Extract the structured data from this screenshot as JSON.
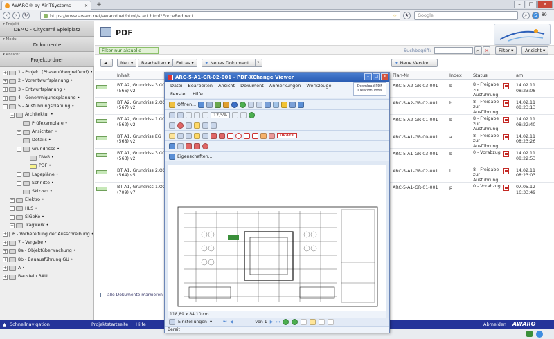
{
  "browser": {
    "tab_title": "AWARO® by AirITSystems",
    "url": "https://www.awaro.net/awaro/net/html/start.html?ForceRedirect",
    "search_engine": "Google"
  },
  "sidebar": {
    "sections": [
      {
        "label": "Projekt",
        "value": "DEMO - Citycarré Spielplatz"
      },
      {
        "label": "Modul",
        "value": "Dokumente"
      },
      {
        "label": "Ansicht",
        "value": "Projektordner"
      }
    ],
    "tree": [
      {
        "level": 0,
        "pm": "+",
        "label": "1 - Projekt (Phasenübergreifend) •"
      },
      {
        "level": 0,
        "pm": "+",
        "label": "2 - Vorentwurfsplanung •"
      },
      {
        "level": 0,
        "pm": "+",
        "label": "3 - Entwurfsplanung •"
      },
      {
        "level": 0,
        "pm": "+",
        "label": "4 - Genehmigungsplanung •"
      },
      {
        "level": 0,
        "pm": "−",
        "label": "5 - Ausführungsplanung •"
      },
      {
        "level": 1,
        "pm": "−",
        "label": "Architektur •"
      },
      {
        "level": 2,
        "pm": "",
        "label": "Prüfexemplare •"
      },
      {
        "level": 2,
        "pm": "+",
        "label": "Ansichten •"
      },
      {
        "level": 2,
        "pm": "",
        "label": "Details •"
      },
      {
        "level": 2,
        "pm": "−",
        "label": "Grundrisse •"
      },
      {
        "level": 3,
        "pm": "",
        "label": "DWG •"
      },
      {
        "level": 3,
        "pm": "",
        "label": "PDF •",
        "selected": true
      },
      {
        "level": 2,
        "pm": "+",
        "label": "Lagepläne •"
      },
      {
        "level": 2,
        "pm": "+",
        "label": "Schnitte •"
      },
      {
        "level": 2,
        "pm": "",
        "label": "Skizzen •"
      },
      {
        "level": 1,
        "pm": "+",
        "label": "Elektro •"
      },
      {
        "level": 1,
        "pm": "+",
        "label": "HLS •"
      },
      {
        "level": 1,
        "pm": "+",
        "label": "SiGeKo •"
      },
      {
        "level": 1,
        "pm": "+",
        "label": "Tragwerk •"
      },
      {
        "level": 0,
        "pm": "+",
        "label": "6 - Vorbereitung der Ausschreibung •"
      },
      {
        "level": 0,
        "pm": "+",
        "label": "7 - Vergabe •"
      },
      {
        "level": 0,
        "pm": "+",
        "label": "8a - Objektüberwachung •"
      },
      {
        "level": 0,
        "pm": "+",
        "label": "8b - Bauausführung GU •"
      },
      {
        "level": 0,
        "pm": "+",
        "label": "A •"
      },
      {
        "level": 0,
        "pm": "+",
        "label": "Baustein BAU"
      }
    ]
  },
  "main": {
    "title": "PDF",
    "filter_active": "Filter nur aktuelle",
    "search_label": "Suchbegriff:",
    "filter_btn": "Filter",
    "view_btn": "Ansicht",
    "toolbar": {
      "back": "",
      "new": "Neu",
      "edit": "Bearbeiten",
      "extras": "Extras",
      "new_doc": "Neues Dokument...",
      "help": "?",
      "new_version": "Neue Version..."
    },
    "columns": {
      "content": "Inhalt",
      "plan_no": "Plan-Nr",
      "index": "Index",
      "status": "Status",
      "date": "am"
    },
    "rows": [
      {
        "content1": "BT A2, Grundriss 3.OG",
        "content2": "(566) v2",
        "plan": "ARC-5-A2-GR-03-001",
        "index": "b",
        "status": "8 - Freigabe zur Ausführung",
        "date": "14.02.11",
        "time": "08:23:08"
      },
      {
        "content1": "BT A2, Grundriss 2.OG",
        "content2": "(567) v2",
        "plan": "ARC-5-A2-GR-02-001",
        "index": "b",
        "status": "8 - Freigabe zur Ausführung",
        "date": "14.02.11",
        "time": "08:23:13"
      },
      {
        "content1": "BT A2, Grundriss 1.OG",
        "content2": "(562) v2",
        "plan": "ARC-5-A2-GR-01-001",
        "index": "b",
        "status": "8 - Freigabe zur Ausführung",
        "date": "14.02.11",
        "time": "08:22:40"
      },
      {
        "content1": "BT A1, Grundriss EG",
        "content2": "(568) v2",
        "plan": "ARC-5-A1-GR-00-001",
        "index": "a",
        "status": "8 - Freigabe zur Ausführung",
        "date": "14.02.11",
        "time": "08:23:26"
      },
      {
        "content1": "BT A1, Grundriss 3.OG",
        "content2": "(563) v2",
        "plan": "ARC-5-A1-GR-03-001",
        "index": "b",
        "status": "0 - Vorabzug",
        "date": "14.02.11",
        "time": "08:22:53"
      },
      {
        "content1": "BT A1, Grundriss 2.OG",
        "content2": "(564) v5",
        "plan": "ARC-5-A1-GR-02-001",
        "index": "l",
        "status": "8 - Freigabe zur Ausführung",
        "date": "14.02.11",
        "time": "08:23:03"
      },
      {
        "content1": "BT A1, Grundriss 1.OG",
        "content2": "(709) v7",
        "plan": "ARC-5-A1-GR-01-001",
        "index": "p",
        "status": "0 - Vorabzug",
        "date": "07.05.12",
        "time": "16:33:49"
      }
    ],
    "mark_all": "alle Dokumente markieren"
  },
  "strip": {
    "quicknav": "Schnellnavigation",
    "projectstart": "Projektstartseite",
    "help": "Hilfe",
    "logout": "Abmelden",
    "brand": "AWARO"
  },
  "viewer": {
    "title": "ARC-5-A1-GR-02-001 - PDF-XChange Viewer",
    "menu": [
      "Datei",
      "Bearbeiten",
      "Ansicht",
      "Dokument",
      "Anmerkungen",
      "Werkzeuge"
    ],
    "menu2": [
      "Fenster",
      "Hilfe"
    ],
    "download": "Download PDF Creation Tools",
    "open_btn": "Öffnen...",
    "zoom": "12,5%",
    "properties": "Eigenschaften...",
    "draft": "DRAFT",
    "dimensions": "118,89 x 84,10 cm",
    "settings": "Einstellungen",
    "page": "von 1",
    "status": "Bereit"
  },
  "colors": {
    "accent": "#24349a",
    "viewer_title": "#2a5cb3",
    "selected_folder": "#f7f28b"
  }
}
